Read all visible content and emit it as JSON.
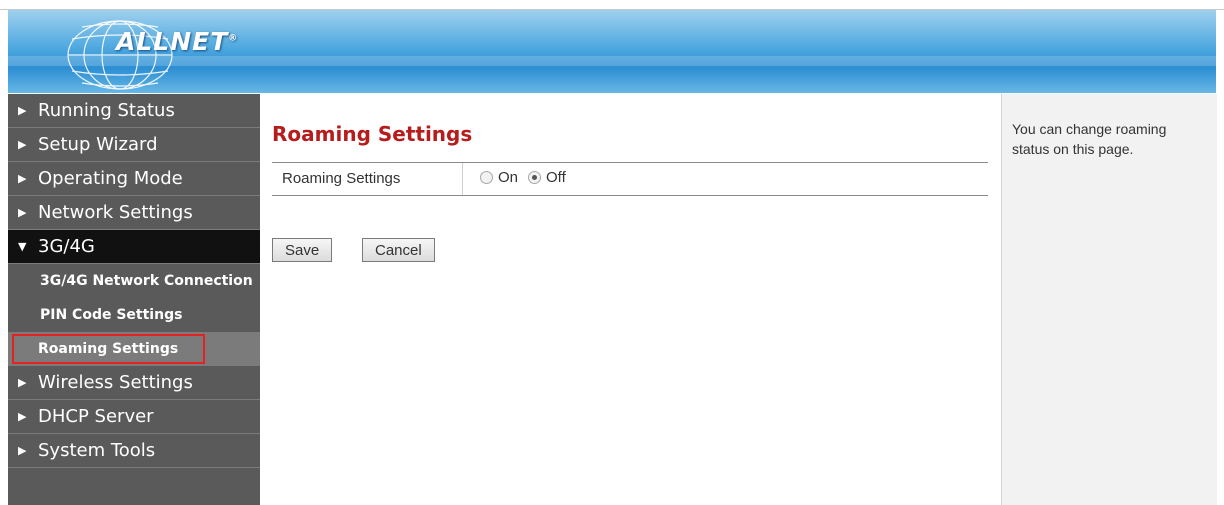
{
  "header": {
    "logo": {
      "text": "ALLNET",
      "registered": "®"
    }
  },
  "sidebar": {
    "items": [
      {
        "label": "Running Status",
        "type": "main",
        "arrow": "▶"
      },
      {
        "label": "Setup Wizard",
        "type": "main",
        "arrow": "▶"
      },
      {
        "label": "Operating Mode",
        "type": "main",
        "arrow": "▶"
      },
      {
        "label": "Network Settings",
        "type": "main",
        "arrow": "▶"
      },
      {
        "label": "3G/4G",
        "type": "main",
        "arrow": "▼",
        "active": true
      },
      {
        "label": "3G/4G Network Connection",
        "type": "sub"
      },
      {
        "label": "PIN Code Settings",
        "type": "sub"
      },
      {
        "label": "Roaming Settings",
        "type": "sub",
        "selected": true
      },
      {
        "label": "Wireless Settings",
        "type": "main",
        "arrow": "▶"
      },
      {
        "label": "DHCP Server",
        "type": "main",
        "arrow": "▶"
      },
      {
        "label": "System Tools",
        "type": "main",
        "arrow": "▶"
      }
    ]
  },
  "main": {
    "title": "Roaming Settings",
    "form": {
      "label": "Roaming Settings",
      "options": [
        {
          "label": "On",
          "checked": false
        },
        {
          "label": "Off",
          "checked": true
        }
      ]
    },
    "buttons": {
      "save": "Save",
      "cancel": "Cancel"
    }
  },
  "help": {
    "text": "You can change roaming status on this page."
  },
  "colors": {
    "header_blue": "#2d8ed3",
    "sidebar_bg": "#5a5a5a",
    "active_bg": "#111111",
    "title_red": "#b71c1c",
    "highlight_red": "#e52222",
    "help_bg": "#f2f2f2"
  }
}
